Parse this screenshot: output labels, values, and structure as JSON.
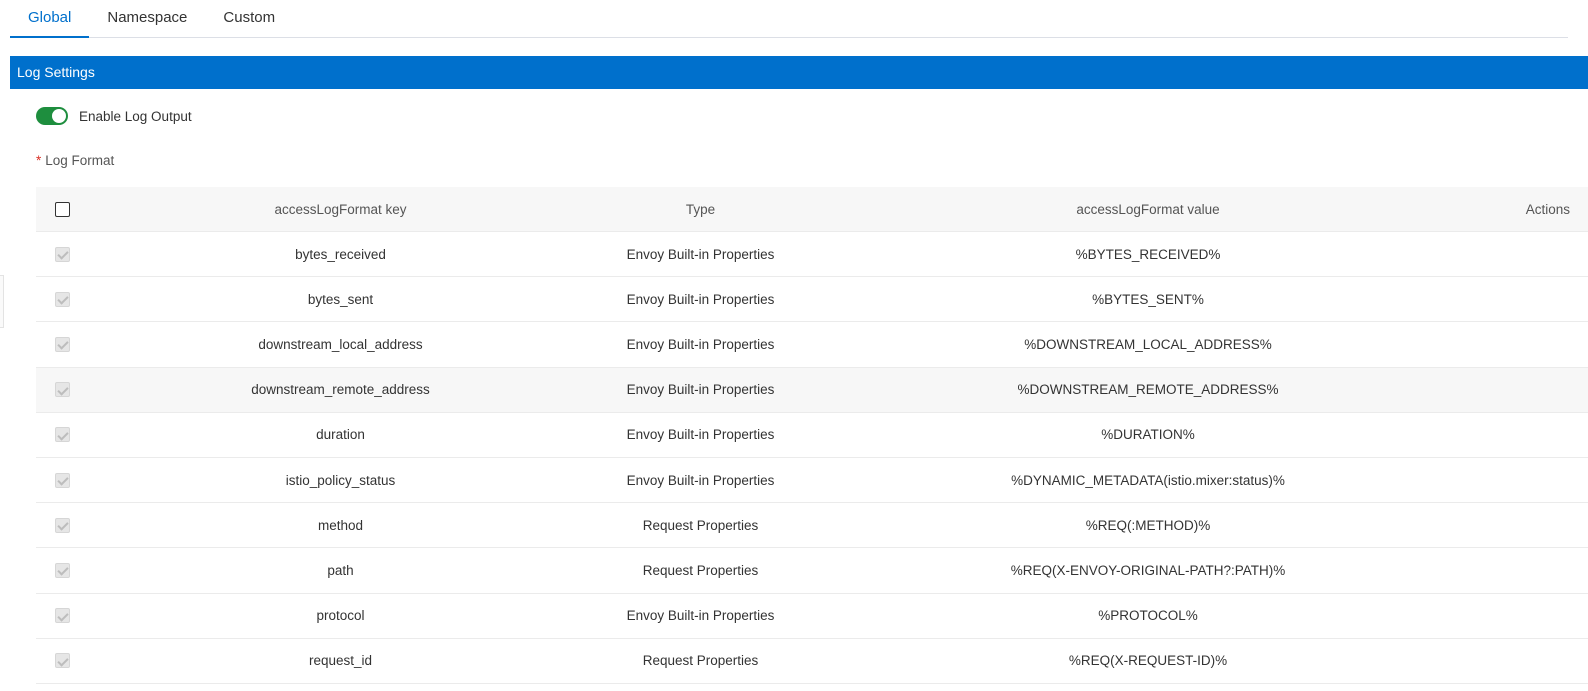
{
  "tabs": [
    {
      "label": "Global",
      "active": true
    },
    {
      "label": "Namespace",
      "active": false
    },
    {
      "label": "Custom",
      "active": false
    }
  ],
  "section": {
    "title": "Log Settings"
  },
  "log_output": {
    "label": "Enable Log Output",
    "enabled": true
  },
  "log_format": {
    "required_mark": "*",
    "label": "Log Format"
  },
  "table": {
    "columns": {
      "key": "accessLogFormat key",
      "type": "Type",
      "value": "accessLogFormat value",
      "actions": "Actions"
    },
    "rows": [
      {
        "key": "bytes_received",
        "type": "Envoy Built-in Properties",
        "value": "%BYTES_RECEIVED%"
      },
      {
        "key": "bytes_sent",
        "type": "Envoy Built-in Properties",
        "value": "%BYTES_SENT%"
      },
      {
        "key": "downstream_local_address",
        "type": "Envoy Built-in Properties",
        "value": "%DOWNSTREAM_LOCAL_ADDRESS%"
      },
      {
        "key": "downstream_remote_address",
        "type": "Envoy Built-in Properties",
        "value": "%DOWNSTREAM_REMOTE_ADDRESS%"
      },
      {
        "key": "duration",
        "type": "Envoy Built-in Properties",
        "value": "%DURATION%"
      },
      {
        "key": "istio_policy_status",
        "type": "Envoy Built-in Properties",
        "value": "%DYNAMIC_METADATA(istio.mixer:status)%"
      },
      {
        "key": "method",
        "type": "Request Properties",
        "value": "%REQ(:METHOD)%"
      },
      {
        "key": "path",
        "type": "Request Properties",
        "value": "%REQ(X-ENVOY-ORIGINAL-PATH?:PATH)%"
      },
      {
        "key": "protocol",
        "type": "Envoy Built-in Properties",
        "value": "%PROTOCOL%"
      },
      {
        "key": "request_id",
        "type": "Request Properties",
        "value": "%REQ(X-REQUEST-ID)%"
      }
    ]
  },
  "colors": {
    "accent": "#0070cc",
    "toggle_on": "#1e8e3e",
    "required": "#d93026"
  }
}
